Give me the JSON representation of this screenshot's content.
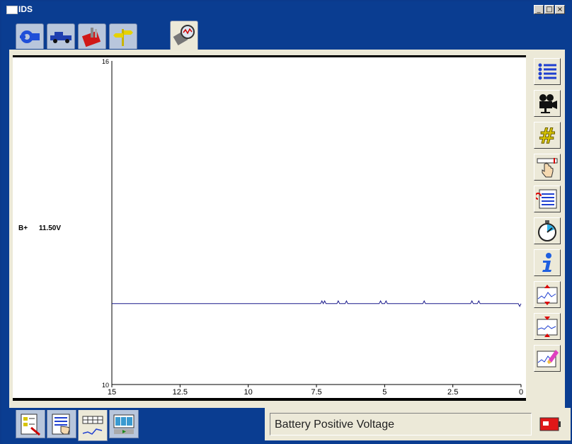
{
  "window": {
    "title": "IDS",
    "controls": [
      "_",
      "□",
      "×"
    ]
  },
  "top_tabs": [
    {
      "icon": "connector-icon",
      "active": false
    },
    {
      "icon": "vehicle-icon",
      "active": false
    },
    {
      "icon": "toolbox-icon",
      "active": false
    },
    {
      "icon": "signpost-icon",
      "active": false
    },
    {
      "icon": "data-logger-icon",
      "active": true
    }
  ],
  "plot": {
    "signal_name": "B+",
    "signal_value": "11.50V",
    "line_color": "#1a1a8c"
  },
  "chart_data": {
    "type": "line",
    "title": "",
    "xlabel": "",
    "ylabel": "",
    "ylim": [
      10,
      16
    ],
    "xlim": [
      15,
      0
    ],
    "y_ticks": [
      "16",
      "10"
    ],
    "x_ticks": [
      "15",
      "12.5",
      "10",
      "7.5",
      "5",
      "2.5",
      "0"
    ],
    "series": [
      {
        "name": "B+",
        "x": [
          15,
          7.35,
          7.3,
          7.25,
          7.2,
          7.15,
          7.1,
          6.75,
          6.7,
          6.65,
          6.45,
          6.4,
          6.35,
          5.2,
          5.15,
          5.1,
          5.0,
          4.95,
          4.9,
          3.6,
          3.55,
          3.5,
          1.85,
          1.8,
          1.75,
          1.6,
          1.55,
          1.5,
          0.1,
          0.05,
          0.0
        ],
        "y": [
          11.5,
          11.5,
          11.55,
          11.5,
          11.55,
          11.5,
          11.5,
          11.5,
          11.55,
          11.5,
          11.5,
          11.55,
          11.5,
          11.5,
          11.55,
          11.5,
          11.5,
          11.55,
          11.5,
          11.5,
          11.55,
          11.5,
          11.5,
          11.55,
          11.5,
          11.5,
          11.55,
          11.5,
          11.5,
          11.45,
          11.5
        ]
      }
    ]
  },
  "side_toolbar": [
    {
      "icon": "list-icon"
    },
    {
      "icon": "camera-icon"
    },
    {
      "icon": "hash-icon"
    },
    {
      "icon": "pointer-scale-icon"
    },
    {
      "icon": "record-list-icon"
    },
    {
      "icon": "stopwatch-icon"
    },
    {
      "icon": "info-icon"
    },
    {
      "icon": "zoom-in-graph-icon"
    },
    {
      "icon": "zoom-out-graph-icon"
    },
    {
      "icon": "erase-graph-icon"
    }
  ],
  "bottom_tabs": [
    {
      "icon": "pid-select-icon",
      "active": false
    },
    {
      "icon": "pid-list-icon",
      "active": false
    },
    {
      "icon": "graph-view-icon",
      "active": true
    },
    {
      "icon": "playback-icon",
      "active": false
    }
  ],
  "status": {
    "text": "Battery Positive Voltage"
  },
  "battery_button": {
    "icon": "battery-icon"
  }
}
